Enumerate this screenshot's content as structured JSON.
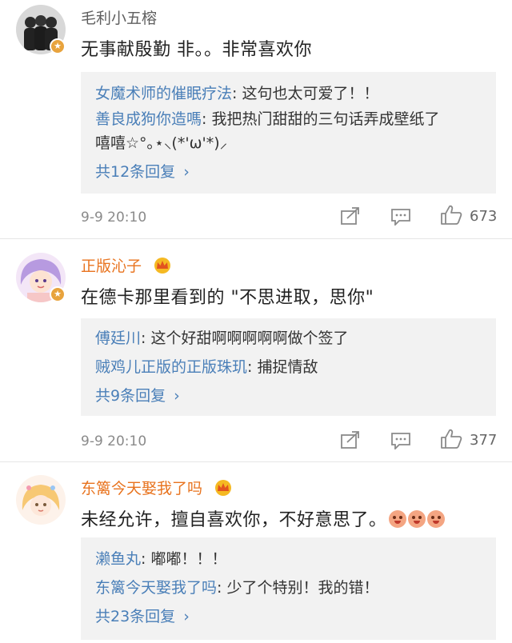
{
  "comments": [
    {
      "username": "毛利小五榕",
      "text": "无事献殷勤 非。。非常喜欢你",
      "replies": [
        {
          "name": "女魔术师的催眠疗法",
          "text": "这句也太可爱了！！"
        },
        {
          "name": "善良成狗你造嗎",
          "text": "我把热门甜甜的三句话弄成壁纸了",
          "text2": "嘻嘻☆°｡⋆⸜(*'ω'*)⸝"
        }
      ],
      "more_replies": "共12条回复",
      "time": "9-9 20:10",
      "likes": "673"
    },
    {
      "username": "正版沁子",
      "text": "在德卡那里看到的 \"不思进取，思你\"",
      "replies": [
        {
          "name": "傅廷川",
          "text": "这个好甜啊啊啊啊啊做个签了"
        },
        {
          "name": "贼鸡儿正版的正版珠玑",
          "text": "捕捉情敌"
        }
      ],
      "more_replies": "共9条回复",
      "time": "9-9 20:10",
      "likes": "377"
    },
    {
      "username": "东篱今天娶我了吗",
      "text": "未经允许，擅自喜欢你，不好意思了。",
      "replies": [
        {
          "name": "濑鱼丸",
          "text": "嘟嘟！！！"
        },
        {
          "name": "东篱今天娶我了吗",
          "text": "少了个特别！我的错！"
        }
      ],
      "more_replies": "共23条回复"
    }
  ],
  "icons": {
    "chevron": "›",
    "forward": "forward-icon",
    "comment": "comment-icon",
    "like": "thumbs-up-icon",
    "crown": "crown-icon",
    "verified": "verified-badge-icon"
  },
  "colors": {
    "username_highlight": "#e8731e",
    "link_blue": "#4a7fb8",
    "reply_bg": "#f2f2f2"
  }
}
